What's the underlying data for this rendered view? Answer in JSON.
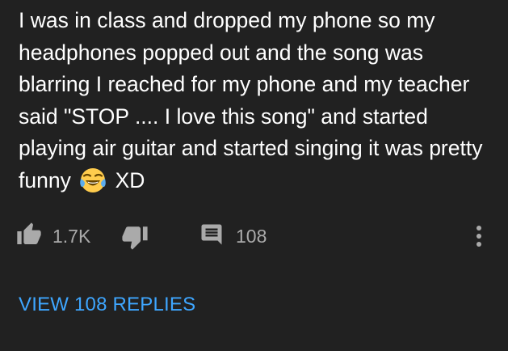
{
  "comment": {
    "text_before_emoji": "I was in class and dropped my phone so my headphones popped out and the song was blarring I reached for my phone and my teacher said \"STOP .... I love this song\" and started playing air guitar and started singing it was pretty funny",
    "emoji": "face-with-tears-of-joy",
    "text_after_emoji": "XD"
  },
  "actions": {
    "like_count": "1.7K",
    "reply_count": "108",
    "like_icon": "thumbs-up-icon",
    "dislike_icon": "thumbs-down-icon",
    "reply_icon": "comment-icon",
    "more_icon": "more-vert-icon",
    "icon_color": "#aaaaaa"
  },
  "replies": {
    "view_label": "VIEW 108 REPLIES",
    "link_color": "#3ea6ff"
  },
  "theme": {
    "background": "#212121",
    "text_color": "#ffffff"
  }
}
